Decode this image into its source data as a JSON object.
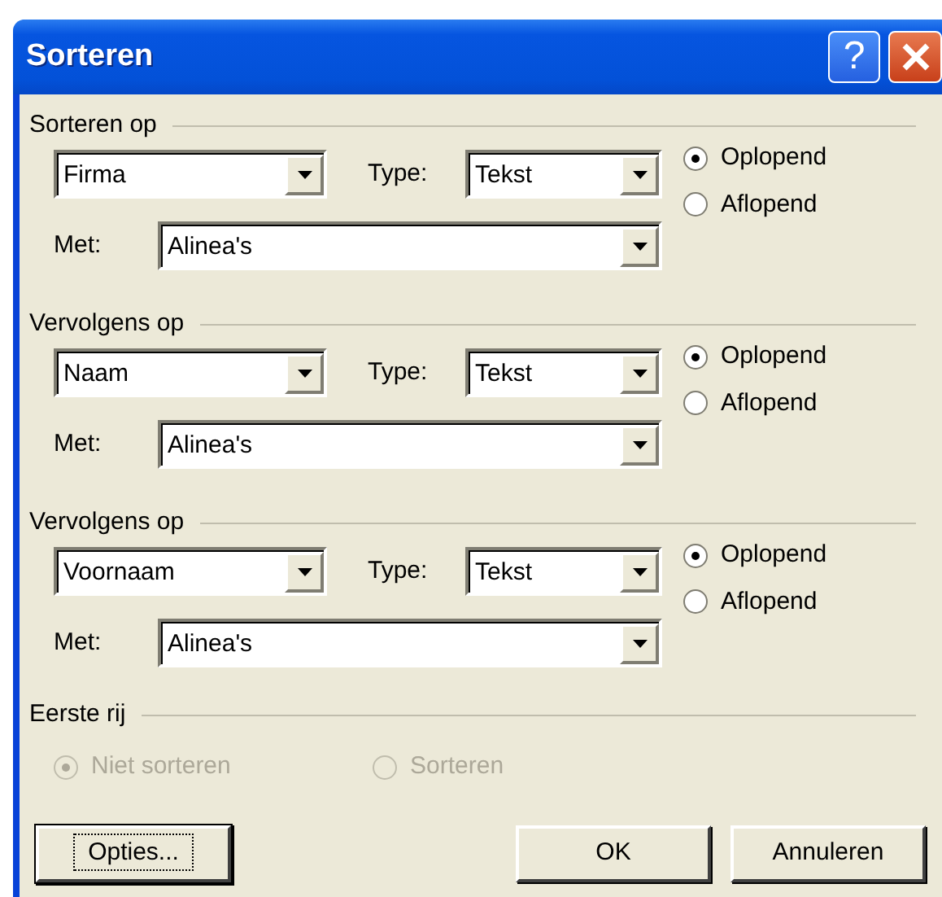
{
  "window": {
    "title": "Sorteren",
    "help_button": "?"
  },
  "sort_levels": [
    {
      "label": "Sorteren op",
      "field": "Firma",
      "type_label": "Type:",
      "type": "Tekst",
      "met_label": "Met:",
      "met": "Alinea's",
      "order_options": [
        {
          "label": "Oplopend",
          "selected": true
        },
        {
          "label": "Aflopend",
          "selected": false
        }
      ]
    },
    {
      "label": "Vervolgens op",
      "field": "Naam",
      "type_label": "Type:",
      "type": "Tekst",
      "met_label": "Met:",
      "met": "Alinea's",
      "order_options": [
        {
          "label": "Oplopend",
          "selected": true
        },
        {
          "label": "Aflopend",
          "selected": false
        }
      ]
    },
    {
      "label": "Vervolgens op",
      "field": "Voornaam",
      "type_label": "Type:",
      "type": "Tekst",
      "met_label": "Met:",
      "met": "Alinea's",
      "order_options": [
        {
          "label": "Oplopend",
          "selected": true
        },
        {
          "label": "Aflopend",
          "selected": false
        }
      ]
    }
  ],
  "first_row": {
    "label": "Eerste rij",
    "disabled": true,
    "options": [
      {
        "label": "Niet sorteren",
        "selected": true
      },
      {
        "label": "Sorteren",
        "selected": false
      }
    ]
  },
  "buttons": [
    {
      "label": "Opties...",
      "focused": true
    },
    {
      "label": "OK",
      "focused": false
    },
    {
      "label": "Annuleren",
      "focused": false
    }
  ]
}
